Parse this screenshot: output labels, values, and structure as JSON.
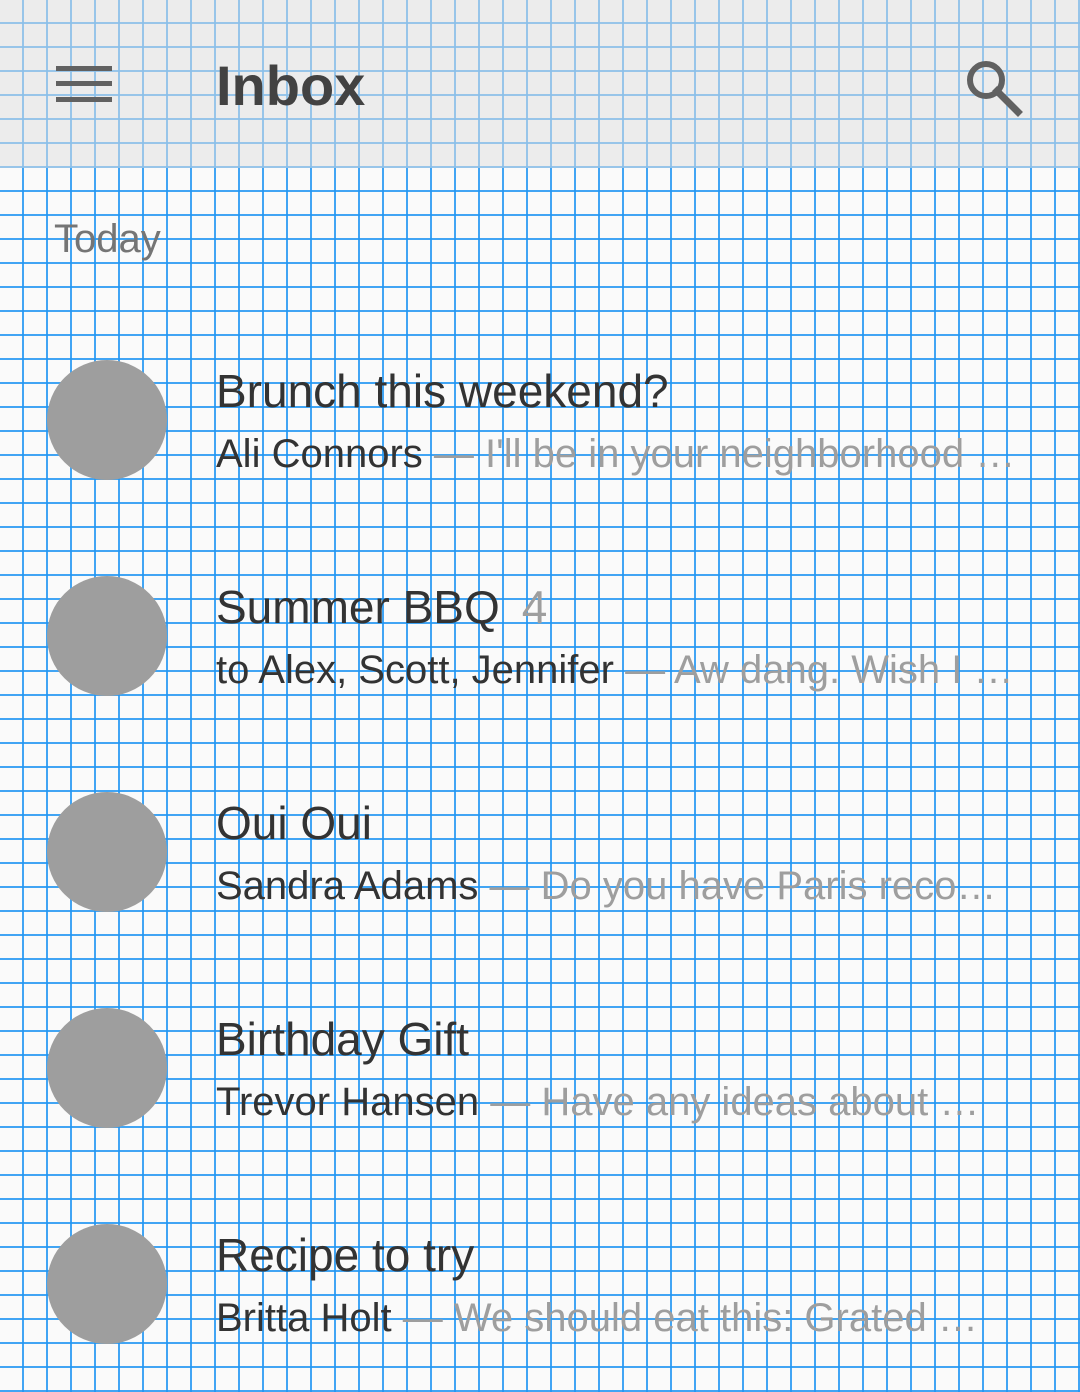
{
  "app_bar": {
    "title": "Inbox",
    "menu_icon": "hamburger-menu-icon",
    "search_icon": "search-icon"
  },
  "section": {
    "label": "Today"
  },
  "messages": [
    {
      "subject": "Brunch this weekend?",
      "count": "",
      "sender": "Ali Connors",
      "separator": "—",
      "snippet": "I'll be in your neighborhood doing errands this weekend."
    },
    {
      "subject": "Summer BBQ",
      "count": "4",
      "sender": "to Alex, Scott, Jennifer",
      "separator": "—",
      "snippet": "Aw dang. Wish I could make it."
    },
    {
      "subject": "Oui Oui",
      "count": "",
      "sender": "Sandra Adams",
      "separator": "—",
      "snippet": "Do you have Paris recommendations?"
    },
    {
      "subject": "Birthday Gift",
      "count": "",
      "sender": "Trevor Hansen",
      "separator": "—",
      "snippet": "Have any ideas about what we should get?"
    },
    {
      "subject": "Recipe to try",
      "count": "",
      "sender": "Britta Holt",
      "separator": "—",
      "snippet": "We should eat this: Grated squash, corn and tomatillo tacos."
    }
  ],
  "colors": {
    "grid_line": "#2196f3",
    "avatar": "#9e9e9e",
    "primary_text": "#333333",
    "secondary_text": "#9e9e9e"
  }
}
